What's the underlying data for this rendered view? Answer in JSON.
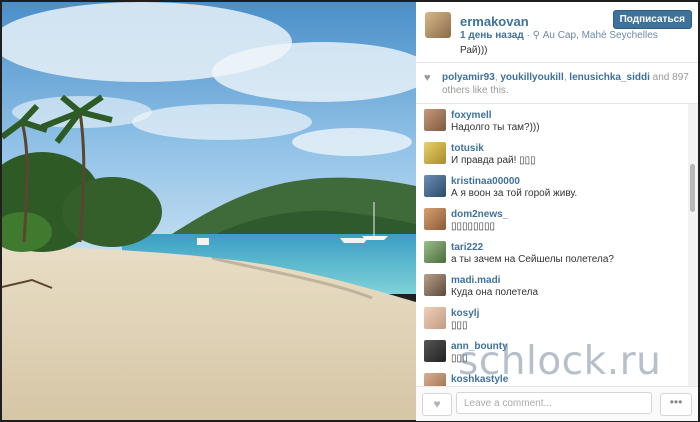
{
  "post": {
    "username": "ermakovan",
    "follow_label": "Подписаться",
    "time": "1 день назад",
    "location_icon": "location-pin-icon",
    "location": "Au Cap, Mahé Seychelles",
    "caption": "Рай)))"
  },
  "likes": {
    "icon": "heart-icon",
    "user1": "polyamir93",
    "user2": "youkillyoukill",
    "user3": "lenusichka_siddi",
    "and_text": "and",
    "count": "897",
    "others_text": "others like this."
  },
  "comments": [
    {
      "user": "foxymell",
      "text": "Надолго ты там?)))"
    },
    {
      "user": "totusik",
      "text": "И правда рай! ▯▯▯"
    },
    {
      "user": "kristinaa00000",
      "text": "А я воон за той горой живу."
    },
    {
      "user": "dom2news_",
      "text": "▯▯▯▯▯▯▯▯"
    },
    {
      "user": "tari222",
      "text": "а ты зачем на Сейшелы полетела?"
    },
    {
      "user": "madi.madi",
      "text": "Куда она полетела"
    },
    {
      "user": "kosylj",
      "text": "▯▯▯"
    },
    {
      "user": "ann_bounty",
      "text": "▯▯▯"
    },
    {
      "user": "koshkastyle",
      "text": ""
    }
  ],
  "footer": {
    "like_icon": "heart-icon",
    "comment_placeholder": "Leave a comment...",
    "more_icon": "more-dots-icon"
  },
  "watermark": "schlock.ru"
}
